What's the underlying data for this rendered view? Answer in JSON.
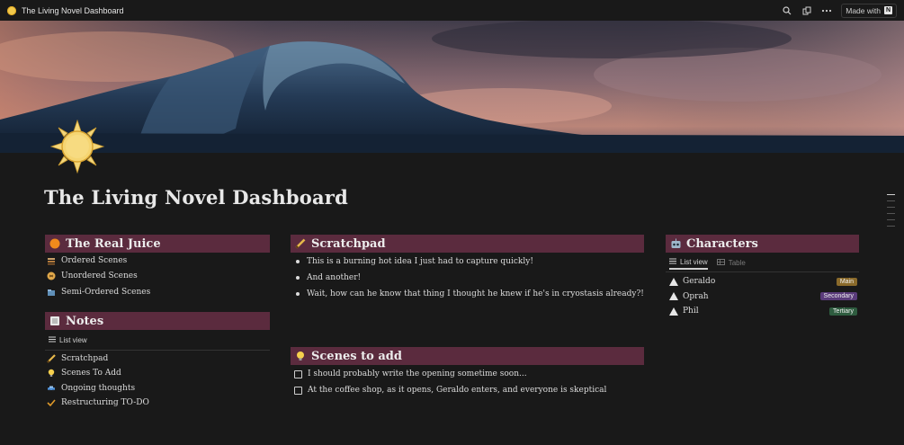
{
  "topbar": {
    "title": "The Living Novel Dashboard",
    "made_with": "Made with"
  },
  "page": {
    "title": "The Living Novel Dashboard"
  },
  "real_juice": {
    "heading": "The Real Juice",
    "items": [
      {
        "label": "Ordered Scenes",
        "icon": "stack-icon"
      },
      {
        "label": "Unordered Scenes",
        "icon": "shuffle-icon"
      },
      {
        "label": "Semi-Ordered Scenes",
        "icon": "folder-icon"
      }
    ]
  },
  "notes": {
    "heading": "Notes",
    "view_label": "List view",
    "items": [
      {
        "label": "Scratchpad",
        "icon": "pencil-icon"
      },
      {
        "label": "Scenes To Add",
        "icon": "lightbulb-icon"
      },
      {
        "label": "Ongoing thoughts",
        "icon": "car-icon"
      },
      {
        "label": "Restructuring TO-DO",
        "icon": "check-icon"
      }
    ]
  },
  "scratchpad": {
    "heading": "Scratchpad",
    "bullets": [
      "This is a burning hot idea I just had to capture quickly!",
      "And another!",
      "Wait, how can he know that thing I thought he knew if he's in cryostasis already?!"
    ]
  },
  "scenes_to_add": {
    "heading": "Scenes to add",
    "todos": [
      "I should probably write the opening sometime soon...",
      "At the coffee shop, as it opens, Geraldo enters, and everyone is skeptical"
    ]
  },
  "characters": {
    "heading": "Characters",
    "tabs": {
      "list": "List view",
      "table": "Table"
    },
    "items": [
      {
        "name": "Geraldo",
        "tag": "Main"
      },
      {
        "name": "Oprah",
        "tag": "Secondary"
      },
      {
        "name": "Phil",
        "tag": "Tertiary"
      }
    ]
  },
  "colors": {
    "header_bg": "#5b2b3e",
    "page_bg": "#191919",
    "tag_main": "#8a6a2b",
    "tag_secondary": "#5a3b7a",
    "tag_tertiary": "#2e5c3f"
  }
}
